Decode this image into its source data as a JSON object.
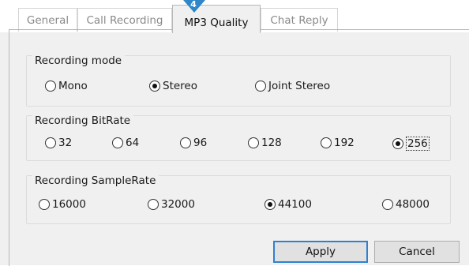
{
  "tabs": [
    {
      "label": "General",
      "active": false
    },
    {
      "label": "Call Recording",
      "active": false
    },
    {
      "label": "MP3 Quality",
      "active": true
    },
    {
      "label": "Chat Reply",
      "active": false
    }
  ],
  "step_badge": "4",
  "groups": {
    "mode": {
      "title": "Recording mode",
      "options": [
        {
          "label": "Mono",
          "checked": false
        },
        {
          "label": "Stereo",
          "checked": true
        },
        {
          "label": "Joint Stereo",
          "checked": false
        }
      ]
    },
    "bitrate": {
      "title": "Recording BitRate",
      "options": [
        {
          "label": "32",
          "checked": false
        },
        {
          "label": "64",
          "checked": false
        },
        {
          "label": "96",
          "checked": false
        },
        {
          "label": "128",
          "checked": false
        },
        {
          "label": "192",
          "checked": false
        },
        {
          "label": "256",
          "checked": true,
          "focused": true
        }
      ]
    },
    "samplerate": {
      "title": "Recording SampleRate",
      "options": [
        {
          "label": "16000",
          "checked": false
        },
        {
          "label": "32000",
          "checked": false
        },
        {
          "label": "44100",
          "checked": true
        },
        {
          "label": "48000",
          "checked": false
        }
      ]
    }
  },
  "buttons": {
    "apply": "Apply",
    "cancel": "Cancel"
  },
  "colors": {
    "accent": "#2f80d0",
    "badge": "#2f86c9",
    "background": "#f0f0f0"
  }
}
